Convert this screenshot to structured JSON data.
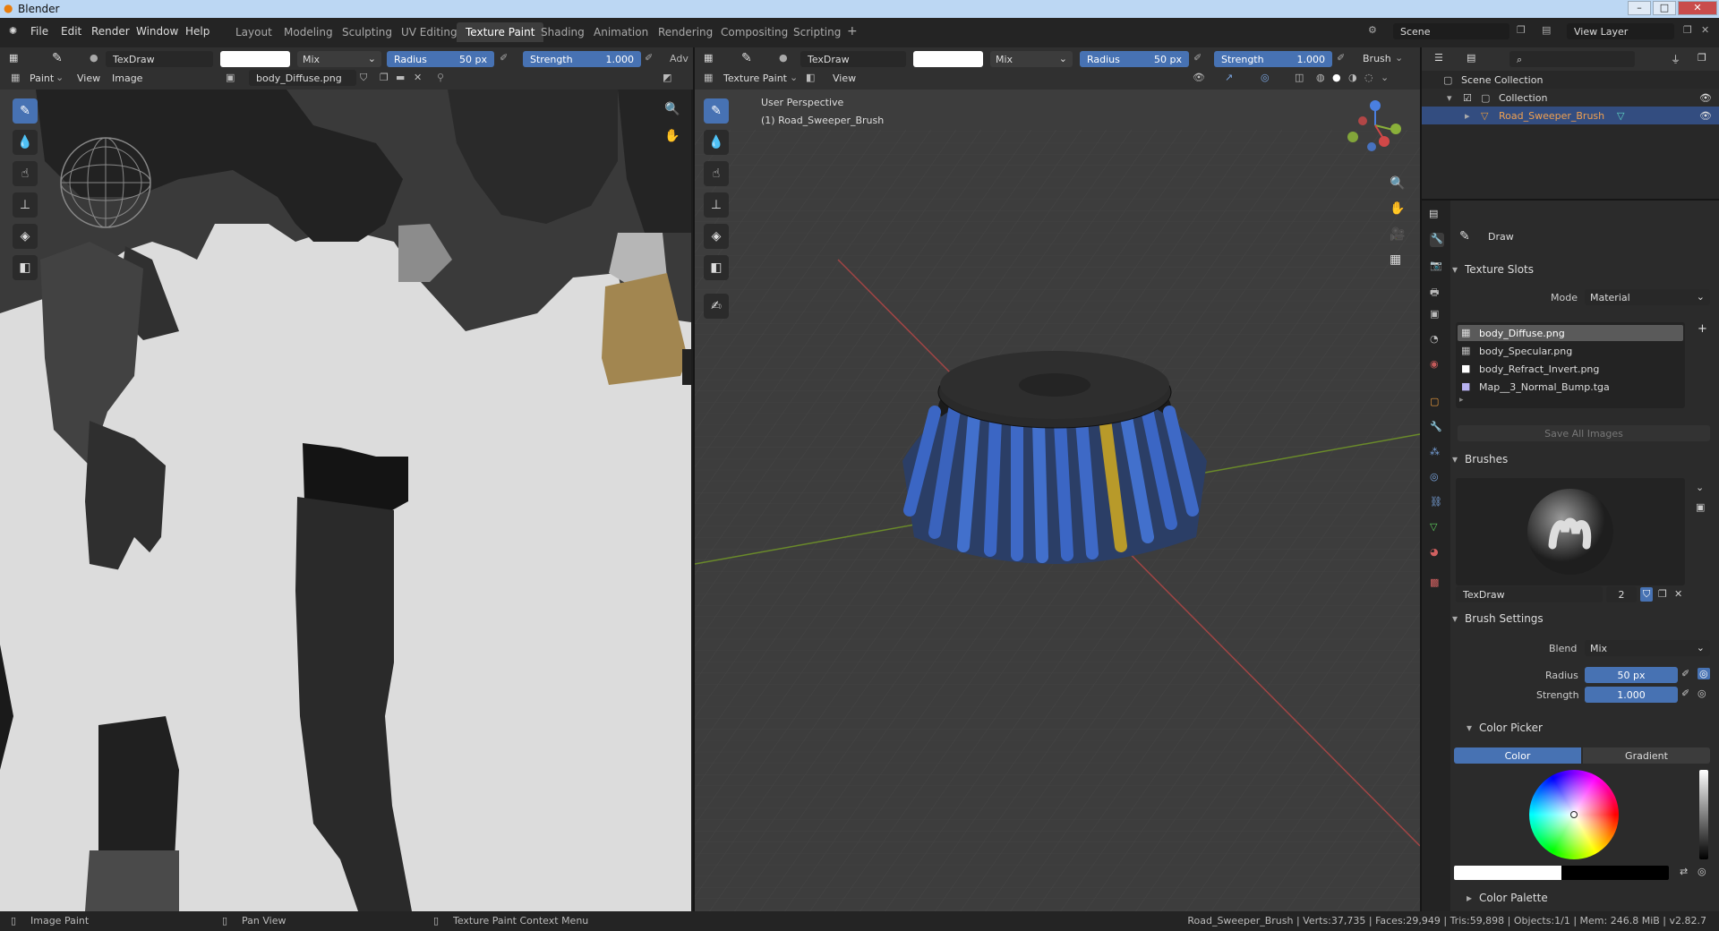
{
  "window": {
    "title": "Blender"
  },
  "menus": [
    "File",
    "Edit",
    "Render",
    "Window",
    "Help"
  ],
  "workspaces": [
    "Layout",
    "Modeling",
    "Sculpting",
    "UV Editing",
    "Texture Paint",
    "Shading",
    "Animation",
    "Rendering",
    "Compositing",
    "Scripting"
  ],
  "active_workspace": "Texture Paint",
  "scene": {
    "name": "Scene",
    "view_layer": "View Layer"
  },
  "image_editor": {
    "brush": "TexDraw",
    "blend": "Mix",
    "radius_label": "Radius",
    "radius": "50 px",
    "strength_label": "Strength",
    "strength": "1.000",
    "adv": "Adv",
    "mode": "Paint",
    "view": "View",
    "image_menu": "Image",
    "image": "body_Diffuse.png"
  },
  "viewport": {
    "brush": "TexDraw",
    "blend": "Mix",
    "radius_label": "Radius",
    "radius": "50 px",
    "strength_label": "Strength",
    "strength": "1.000",
    "brush_menu": "Brush",
    "mode": "Texture Paint",
    "view": "View",
    "perspective": "User Perspective",
    "object": "(1) Road_Sweeper_Brush"
  },
  "outliner": {
    "scene_collection": "Scene Collection",
    "collection": "Collection",
    "object": "Road_Sweeper_Brush"
  },
  "properties": {
    "tool": "Draw",
    "texture_slots": {
      "title": "Texture Slots",
      "mode_label": "Mode",
      "mode": "Material",
      "slots": [
        "body_Diffuse.png",
        "body_Specular.png",
        "body_Refract_Invert.png",
        "Map__3_Normal_Bump.tga"
      ],
      "save_all": "Save All Images"
    },
    "brushes": {
      "title": "Brushes",
      "name": "TexDraw",
      "users": "2"
    },
    "brush_settings": {
      "title": "Brush Settings",
      "blend_label": "Blend",
      "blend": "Mix",
      "radius_label": "Radius",
      "radius": "50 px",
      "strength_label": "Strength",
      "strength": "1.000"
    },
    "color_picker": {
      "title": "Color Picker",
      "tab_color": "Color",
      "tab_gradient": "Gradient"
    },
    "color_palette": {
      "title": "Color Palette"
    }
  },
  "status": {
    "left": "Image Paint",
    "middle": "Pan View",
    "right": "Texture Paint Context Menu",
    "stats": "Road_Sweeper_Brush | Verts:37,735 | Faces:29,949 | Tris:59,898 | Objects:1/1 | Mem: 246.8 MiB | v2.82.7"
  },
  "colors": {
    "accent": "#4772b3",
    "bristle_blue": "#3b66c4",
    "bristle_yellow": "#b89a2a",
    "header": "#303030"
  }
}
